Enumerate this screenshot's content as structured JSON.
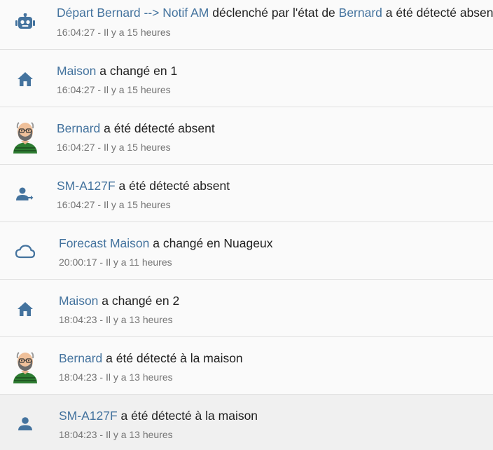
{
  "colors": {
    "link": "#44739e",
    "icon": "#44739e",
    "text": "#212121",
    "secondary": "#737373"
  },
  "entries": [
    {
      "icon": "robot-icon",
      "segments": [
        {
          "text": "Départ Bernard --> Notif AM",
          "link": true
        },
        {
          "text": " déclenché par l'état de ",
          "link": false
        },
        {
          "text": "Bernard",
          "link": true
        },
        {
          "text": " a été détecté absent",
          "link": false
        }
      ],
      "time": "16:04:27 - Il y a 15 heures"
    },
    {
      "icon": "home-icon",
      "segments": [
        {
          "text": "Maison",
          "link": true
        },
        {
          "text": " a changé en 1",
          "link": false
        }
      ],
      "time": "16:04:27 - Il y a 15 heures"
    },
    {
      "icon": "bernard-avatar",
      "segments": [
        {
          "text": "Bernard",
          "link": true
        },
        {
          "text": " a été détecté absent",
          "link": false
        }
      ],
      "time": "16:04:27 - Il y a 15 heures"
    },
    {
      "icon": "account-arrow-right-icon",
      "segments": [
        {
          "text": "SM-A127F",
          "link": true
        },
        {
          "text": " a été détecté absent",
          "link": false
        }
      ],
      "time": "16:04:27 - Il y a 15 heures"
    },
    {
      "icon": "cloud-icon",
      "segments": [
        {
          "text": "Forecast Maison",
          "link": true
        },
        {
          "text": " a changé en Nuageux",
          "link": false
        }
      ],
      "time": "20:00:17 - Il y a 11 heures"
    },
    {
      "icon": "home-icon",
      "segments": [
        {
          "text": "Maison",
          "link": true
        },
        {
          "text": " a changé en 2",
          "link": false
        }
      ],
      "time": "18:04:23 - Il y a 13 heures"
    },
    {
      "icon": "bernard-avatar",
      "segments": [
        {
          "text": "Bernard",
          "link": true
        },
        {
          "text": " a été détecté à la maison",
          "link": false
        }
      ],
      "time": "18:04:23 - Il y a 13 heures"
    },
    {
      "icon": "account-icon",
      "segments": [
        {
          "text": "SM-A127F",
          "link": true
        },
        {
          "text": " a été détecté à la maison",
          "link": false
        }
      ],
      "time": "18:04:23 - Il y a 13 heures"
    }
  ]
}
